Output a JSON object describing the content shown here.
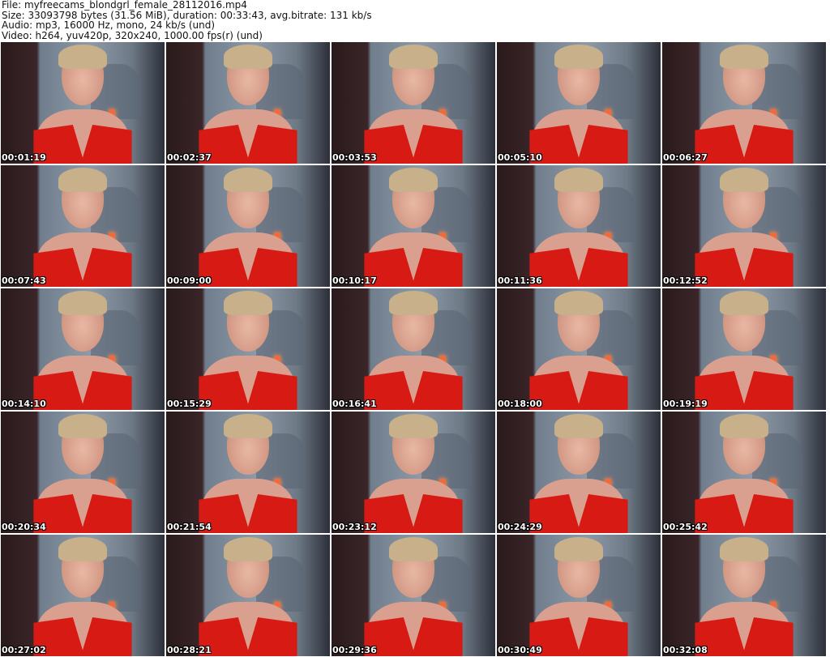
{
  "header": {
    "file": "File: myfreecams_blondgrl_female_28112016.mp4",
    "size": "Size: 33093798 bytes (31.56 MiB), duration: 00:33:43, avg.bitrate: 131 kb/s",
    "audio": "Audio: mp3, 16000 Hz, mono, 24 kb/s (und)",
    "video": "Video: h264, yuv420p, 320x240, 1000.00 fps(r) (und)"
  },
  "timestamps": [
    "00:01:19",
    "00:02:37",
    "00:03:53",
    "00:05:10",
    "00:06:27",
    "00:07:43",
    "00:09:00",
    "00:10:17",
    "00:11:36",
    "00:12:52",
    "00:14:10",
    "00:15:29",
    "00:16:41",
    "00:18:00",
    "00:19:19",
    "00:20:34",
    "00:21:54",
    "00:23:12",
    "00:24:29",
    "00:25:42",
    "00:27:02",
    "00:28:21",
    "00:29:36",
    "00:30:49",
    "00:32:08"
  ]
}
